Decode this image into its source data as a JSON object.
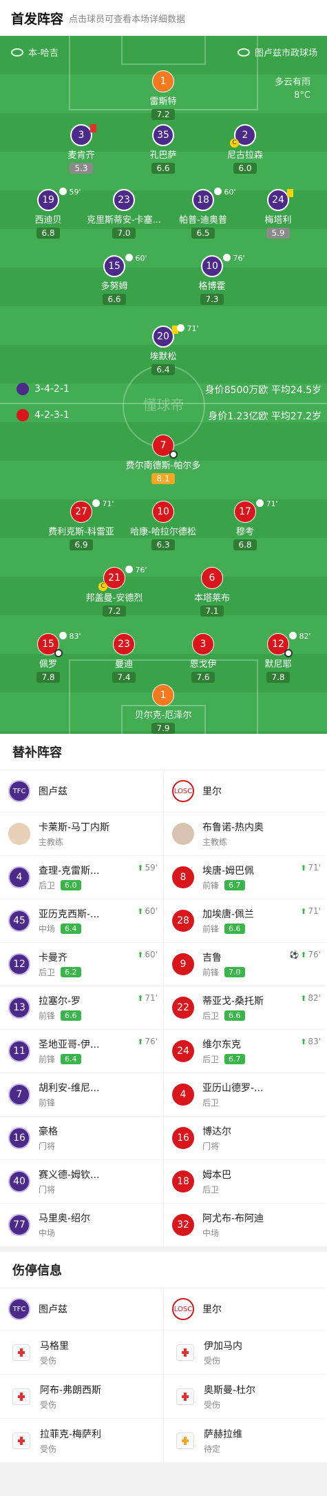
{
  "header": {
    "title": "首发阵容",
    "subtitle": "点击球员可查看本场详细数据"
  },
  "pitch": {
    "home_label": "本-哈吉",
    "stadium": "图卢兹市政球场",
    "weather": "多云有雨",
    "temperature": "8°C",
    "watermark": "懂球帝",
    "home_formation": "3-4-2-1",
    "home_value": "身价8500万欧 平均24.5岁",
    "away_formation": "4-2-3-1",
    "away_value": "身价1.23亿欧 平均27.2岁"
  },
  "home_players": [
    {
      "num": "1",
      "name": "雷斯特",
      "rating": "7.2"
    },
    {
      "num": "3",
      "name": "麦肯齐",
      "rating": "5.3"
    },
    {
      "num": "35",
      "name": "孔巴萨",
      "rating": "6.6"
    },
    {
      "num": "2",
      "name": "尼古拉森",
      "rating": "6.0"
    },
    {
      "num": "19",
      "name": "西迪贝",
      "rating": "6.8",
      "sub": "59'"
    },
    {
      "num": "23",
      "name": "克里斯蒂安-卡塞...",
      "rating": "7.0"
    },
    {
      "num": "18",
      "name": "帕普-迪奥普",
      "rating": "6.5",
      "sub": "60'"
    },
    {
      "num": "24",
      "name": "梅塔利",
      "rating": "5.9"
    },
    {
      "num": "15",
      "name": "多努姆",
      "rating": "6.6",
      "sub": "60'"
    },
    {
      "num": "10",
      "name": "格博霍",
      "rating": "7.3",
      "sub": "76'"
    },
    {
      "num": "20",
      "name": "埃默松",
      "rating": "6.4",
      "sub": "71'"
    }
  ],
  "away_players": [
    {
      "num": "7",
      "name": "费尔南德斯-帕尔多",
      "rating": "8.1"
    },
    {
      "num": "27",
      "name": "费利克斯-科雷亚",
      "rating": "6.9",
      "sub": "71'"
    },
    {
      "num": "10",
      "name": "哈康-哈拉尔德松",
      "rating": "6.3"
    },
    {
      "num": "17",
      "name": "穆考",
      "rating": "6.8",
      "sub": "71'"
    },
    {
      "num": "21",
      "name": "邦盖曼-安德烈",
      "rating": "7.2",
      "sub": "76'"
    },
    {
      "num": "6",
      "name": "本塔莱布",
      "rating": "7.1"
    },
    {
      "num": "15",
      "name": "佩罗",
      "rating": "7.8",
      "sub": "83'"
    },
    {
      "num": "23",
      "name": "曼迪",
      "rating": "7.4"
    },
    {
      "num": "3",
      "name": "恩戈伊",
      "rating": "7.6"
    },
    {
      "num": "12",
      "name": "默尼耶",
      "rating": "7.8",
      "sub": "82'"
    },
    {
      "num": "1",
      "name": "贝尔克-厄泽尔",
      "rating": "7.9"
    }
  ],
  "subs_section": {
    "title": "替补阵容",
    "home_club": "图卢兹",
    "away_club": "里尔",
    "home_coach": {
      "name": "卡莱斯-马丁内斯",
      "role": "主教练"
    },
    "away_coach": {
      "name": "布鲁诺-热内奥",
      "role": "主教练"
    },
    "home": [
      {
        "num": "4",
        "name": "查理-克雷斯...",
        "pos": "后卫",
        "rating": "6.0",
        "minute": "59'"
      },
      {
        "num": "45",
        "name": "亚历克西斯-...",
        "pos": "中场",
        "rating": "6.4",
        "minute": "60'"
      },
      {
        "num": "12",
        "name": "卡曼齐",
        "pos": "后卫",
        "rating": "6.2",
        "minute": "60'"
      },
      {
        "num": "13",
        "name": "拉塞尔-罗",
        "pos": "前锋",
        "rating": "6.6",
        "minute": "71'"
      },
      {
        "num": "11",
        "name": "圣地亚哥-伊...",
        "pos": "前锋",
        "rating": "6.4",
        "minute": "76'"
      },
      {
        "num": "7",
        "name": "胡利安-维尼...",
        "pos": "前锋"
      },
      {
        "num": "16",
        "name": "豪格",
        "pos": "门将"
      },
      {
        "num": "40",
        "name": "赛义德-姆钦...",
        "pos": "门将"
      },
      {
        "num": "77",
        "name": "马里奥-绍尔",
        "pos": "中场"
      }
    ],
    "away": [
      {
        "num": "8",
        "name": "埃唐-姆巴佩",
        "pos": "前锋",
        "rating": "6.7",
        "minute": "71'"
      },
      {
        "num": "28",
        "name": "加埃唐-佩兰",
        "pos": "前锋",
        "rating": "6.6",
        "minute": "71'"
      },
      {
        "num": "9",
        "name": "吉鲁",
        "pos": "前锋",
        "rating": "7.0",
        "minute": "76'"
      },
      {
        "num": "22",
        "name": "蒂亚戈-桑托斯",
        "pos": "后卫",
        "rating": "6.6",
        "minute": "82'"
      },
      {
        "num": "24",
        "name": "维尔东克",
        "pos": "后卫",
        "rating": "6.7",
        "minute": "83'"
      },
      {
        "num": "4",
        "name": "亚历山德罗-...",
        "pos": "后卫"
      },
      {
        "num": "16",
        "name": "博达尔",
        "pos": "门将"
      },
      {
        "num": "18",
        "name": "姆本巴",
        "pos": "后卫"
      },
      {
        "num": "32",
        "name": "阿尤布-布阿迪",
        "pos": "中场"
      }
    ]
  },
  "injury_section": {
    "title": "伤停信息",
    "home_club": "图卢兹",
    "away_club": "里尔",
    "home": [
      {
        "name": "马格里",
        "status": "受伤"
      },
      {
        "name": "阿布-弗朗西斯",
        "status": "受伤"
      },
      {
        "name": "拉菲克-梅萨利",
        "status": "受伤"
      }
    ],
    "away": [
      {
        "name": "伊加马内",
        "status": "受伤"
      },
      {
        "name": "奥斯曼-杜尔",
        "status": "受伤"
      },
      {
        "name": "萨赫拉维",
        "status": "待定"
      }
    ]
  },
  "colors": {
    "pitch": "#3aa34a",
    "toulouse": "#4b2a8a",
    "lille": "#d9161c",
    "gk": "#f47a1f",
    "rating": "#2e7d32"
  }
}
